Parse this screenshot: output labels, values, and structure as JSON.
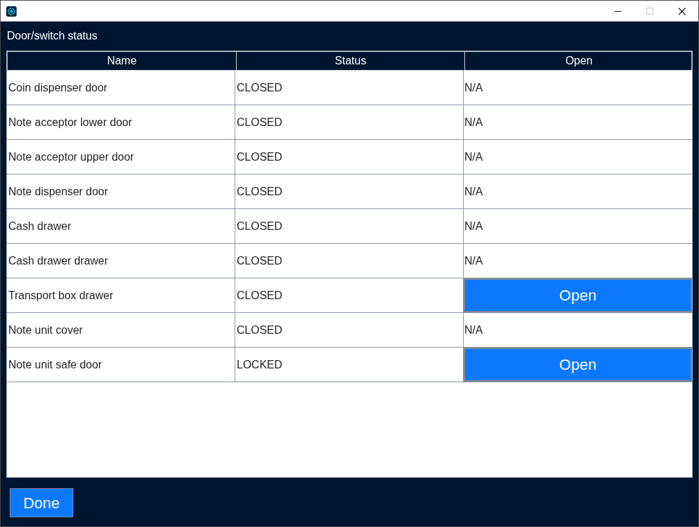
{
  "window": {
    "maximize_disabled": true
  },
  "heading": "Door/switch status",
  "table": {
    "columns": [
      "Name",
      "Status",
      "Open"
    ],
    "rows": [
      {
        "name": "Coin dispenser door",
        "status": "CLOSED",
        "open": {
          "kind": "text",
          "label": "N/A"
        }
      },
      {
        "name": "Note acceptor lower door",
        "status": "CLOSED",
        "open": {
          "kind": "text",
          "label": "N/A"
        }
      },
      {
        "name": "Note acceptor upper door",
        "status": "CLOSED",
        "open": {
          "kind": "text",
          "label": "N/A"
        }
      },
      {
        "name": "Note dispenser door",
        "status": "CLOSED",
        "open": {
          "kind": "text",
          "label": "N/A"
        }
      },
      {
        "name": "Cash drawer",
        "status": "CLOSED",
        "open": {
          "kind": "text",
          "label": "N/A"
        }
      },
      {
        "name": "Cash drawer drawer",
        "status": "CLOSED",
        "open": {
          "kind": "text",
          "label": "N/A"
        }
      },
      {
        "name": "Transport box drawer",
        "status": "CLOSED",
        "open": {
          "kind": "button",
          "label": "Open"
        }
      },
      {
        "name": "Note unit cover",
        "status": "CLOSED",
        "open": {
          "kind": "text",
          "label": "N/A"
        }
      },
      {
        "name": "Note unit safe door",
        "status": "LOCKED",
        "open": {
          "kind": "button",
          "label": "Open"
        }
      }
    ]
  },
  "buttons": [
    "Done"
  ]
}
